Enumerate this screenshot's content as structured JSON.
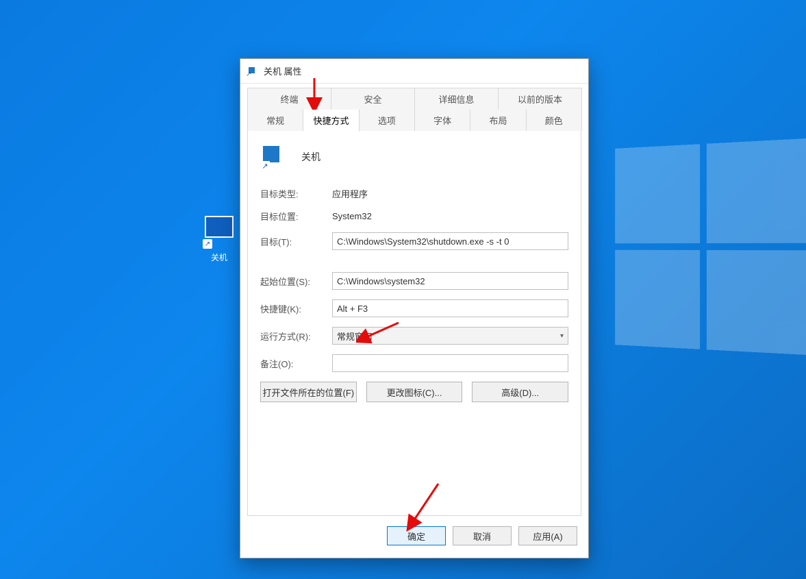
{
  "desktop": {
    "shortcut_label": "关机"
  },
  "dialog": {
    "title": "关机 属性",
    "tabs_row1": [
      "终端",
      "安全",
      "详细信息",
      "以前的版本"
    ],
    "tabs_row2": [
      "常规",
      "快捷方式",
      "选项",
      "字体",
      "布局",
      "颜色"
    ],
    "active_tab": "快捷方式",
    "shortcut_name": "关机",
    "labels": {
      "target_type": "目标类型:",
      "target_location": "目标位置:",
      "target": "目标(T):",
      "start_in": "起始位置(S):",
      "shortcut_key": "快捷键(K):",
      "run": "运行方式(R):",
      "comment": "备注(O):"
    },
    "values": {
      "target_type": "应用程序",
      "target_location": "System32",
      "target": "C:\\Windows\\System32\\shutdown.exe -s -t 0",
      "start_in": "C:\\Windows\\system32",
      "shortcut_key": "Alt + F3",
      "run": "常规窗口",
      "comment": ""
    },
    "action_buttons": {
      "open_location": "打开文件所在的位置(F)",
      "change_icon": "更改图标(C)...",
      "advanced": "高级(D)..."
    },
    "dialog_buttons": {
      "ok": "确定",
      "cancel": "取消",
      "apply": "应用(A)"
    }
  }
}
